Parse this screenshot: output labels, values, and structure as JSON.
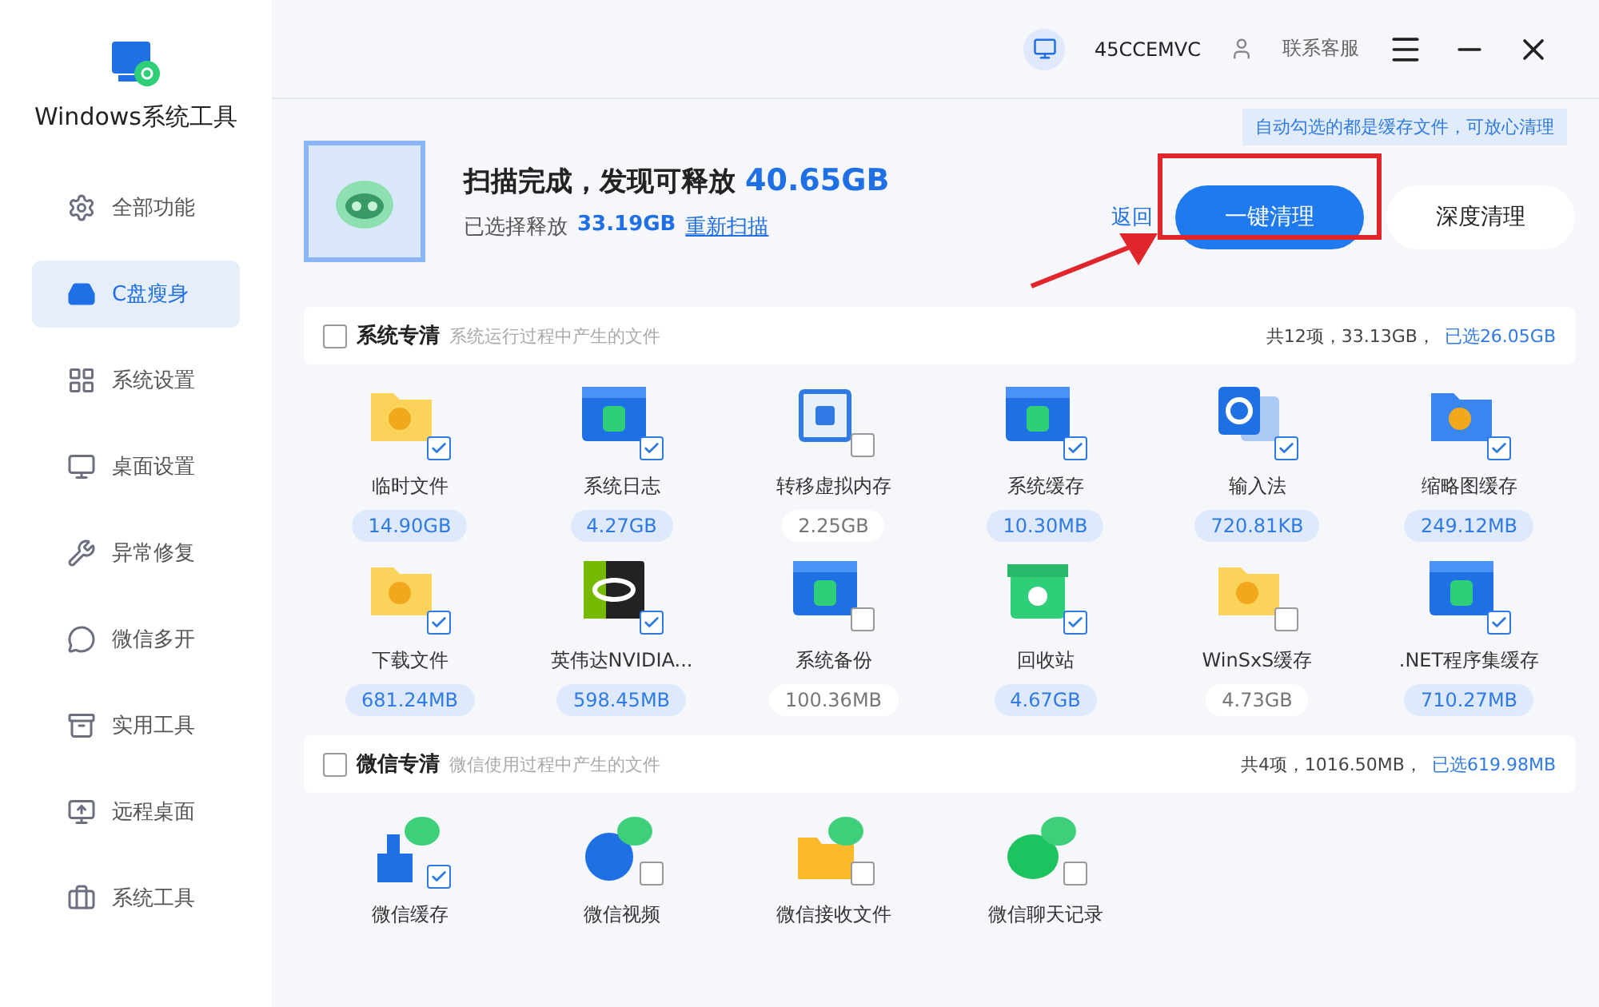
{
  "app": {
    "title": "Windows系统工具"
  },
  "sidebar": {
    "items": [
      {
        "label": "全部功能",
        "selected": false
      },
      {
        "label": "C盘瘦身",
        "selected": true
      },
      {
        "label": "系统设置",
        "selected": false
      },
      {
        "label": "桌面设置",
        "selected": false
      },
      {
        "label": "异常修复",
        "selected": false
      },
      {
        "label": "微信多开",
        "selected": false
      },
      {
        "label": "实用工具",
        "selected": false
      },
      {
        "label": "远程桌面",
        "selected": false
      },
      {
        "label": "系统工具",
        "selected": false
      }
    ]
  },
  "topbar": {
    "account": "45CCEMVC",
    "support": "联系客服"
  },
  "summary": {
    "title": "扫描完成，发现可释放",
    "total": "40.65GB",
    "selected_label": "已选择释放",
    "selected_size": "33.19GB",
    "rescan": "重新扫描"
  },
  "tip": "自动勾选的都是缓存文件，可放心清理",
  "actions": {
    "back": "返回",
    "primary": "一键清理",
    "secondary": "深度清理"
  },
  "sections": [
    {
      "title": "系统专清",
      "checked": false,
      "description": "系统运行过程中产生的文件",
      "total": "共12项，33.13GB，",
      "selected_total": "已选26.05GB",
      "items": [
        {
          "label": "临时文件",
          "size": "14.90GB",
          "checked": true
        },
        {
          "label": "系统日志",
          "size": "4.27GB",
          "checked": true
        },
        {
          "label": "转移虚拟内存",
          "size": "2.25GB",
          "checked": false
        },
        {
          "label": "系统缓存",
          "size": "10.30MB",
          "checked": true
        },
        {
          "label": "输入法",
          "size": "720.81KB",
          "checked": true
        },
        {
          "label": "缩略图缓存",
          "size": "249.12MB",
          "checked": true
        },
        {
          "label": "下载文件",
          "size": "681.24MB",
          "checked": true
        },
        {
          "label": "英伟达NVIDIA...",
          "size": "598.45MB",
          "checked": true
        },
        {
          "label": "系统备份",
          "size": "100.36MB",
          "checked": false
        },
        {
          "label": "回收站",
          "size": "4.67GB",
          "checked": true
        },
        {
          "label": "WinSxS缓存",
          "size": "4.73GB",
          "checked": false
        },
        {
          "label": ".NET程序集缓存",
          "size": "710.27MB",
          "checked": true
        }
      ]
    },
    {
      "title": "微信专清",
      "checked": false,
      "description": "微信使用过程中产生的文件",
      "total": "共4项，1016.50MB，",
      "selected_total": "已选619.98MB",
      "items": [
        {
          "label": "微信缓存",
          "checked": true
        },
        {
          "label": "微信视频",
          "checked": false
        },
        {
          "label": "微信接收文件",
          "checked": false
        },
        {
          "label": "微信聊天记录",
          "checked": false
        }
      ]
    }
  ]
}
